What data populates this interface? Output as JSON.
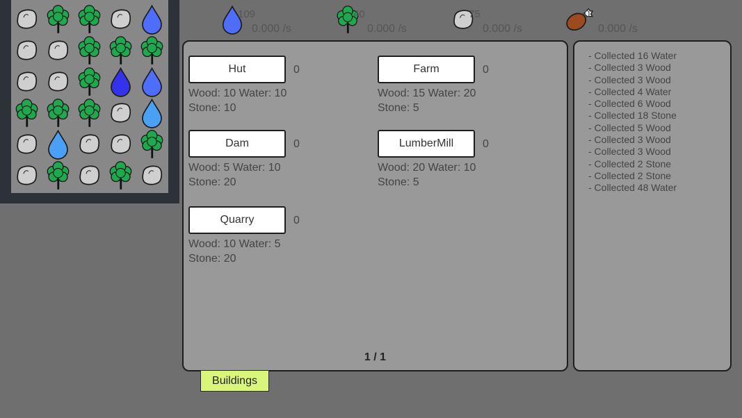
{
  "grid": {
    "rows": [
      [
        "stone",
        "tree",
        "tree",
        "stone",
        "water"
      ],
      [
        "stone",
        "stone",
        "tree",
        "tree",
        "tree"
      ],
      [
        "stone",
        "stone",
        "tree",
        "water-dark",
        "water"
      ],
      [
        "tree",
        "tree",
        "tree",
        "stone",
        "water-light"
      ],
      [
        "stone",
        "water-light",
        "stone",
        "stone",
        "tree"
      ],
      [
        "stone",
        "tree",
        "stone",
        "tree",
        "stone"
      ]
    ]
  },
  "resources": [
    {
      "name": "water",
      "icon": "water-drop-icon",
      "count": "109",
      "rate": "0.000 /s"
    },
    {
      "name": "wood",
      "icon": "tree-icon",
      "count": "40",
      "rate": "0.000 /s"
    },
    {
      "name": "stone",
      "icon": "stone-icon",
      "count": "75",
      "rate": "0.000 /s"
    },
    {
      "name": "food",
      "icon": "meat-icon",
      "count": "0",
      "rate": "0.000 /s"
    }
  ],
  "buildings": [
    {
      "label": "Hut",
      "owned": "0",
      "cost_line1": "Wood: 10  Water: 10",
      "cost_line2": "Stone: 10"
    },
    {
      "label": "Farm",
      "owned": "0",
      "cost_line1": "Wood: 15  Water: 20",
      "cost_line2": "Stone: 5"
    },
    {
      "label": "Dam",
      "owned": "0",
      "cost_line1": "Wood: 5  Water: 10",
      "cost_line2": "Stone: 20"
    },
    {
      "label": "LumberMill",
      "owned": "0",
      "cost_line1": "Wood: 20  Water: 10",
      "cost_line2": "Stone: 5"
    },
    {
      "label": "Quarry",
      "owned": "0",
      "cost_line1": "Wood: 10  Water: 5",
      "cost_line2": "Stone: 20"
    }
  ],
  "page_indicator": "1 / 1",
  "log": [
    "- Collected 16 Water",
    "- Collected 3 Wood",
    "- Collected 3 Wood",
    "- Collected 4 Water",
    "- Collected 6 Wood",
    "- Collected 18 Stone",
    "- Collected 5 Wood",
    "- Collected 3 Wood",
    "- Collected 3 Wood",
    "- Collected 2 Stone",
    "- Collected 2 Stone",
    "- Collected 48 Water"
  ],
  "tabs": {
    "buildings_label": "Buildings"
  },
  "colors": {
    "water": "#4f6dfb",
    "water_dark": "#3333ee",
    "water_light": "#4aa0f5",
    "tree": "#1fa84e",
    "stone": "#cfcfcf",
    "meat": "#9c4a1e",
    "tab": "#d9f57a"
  }
}
